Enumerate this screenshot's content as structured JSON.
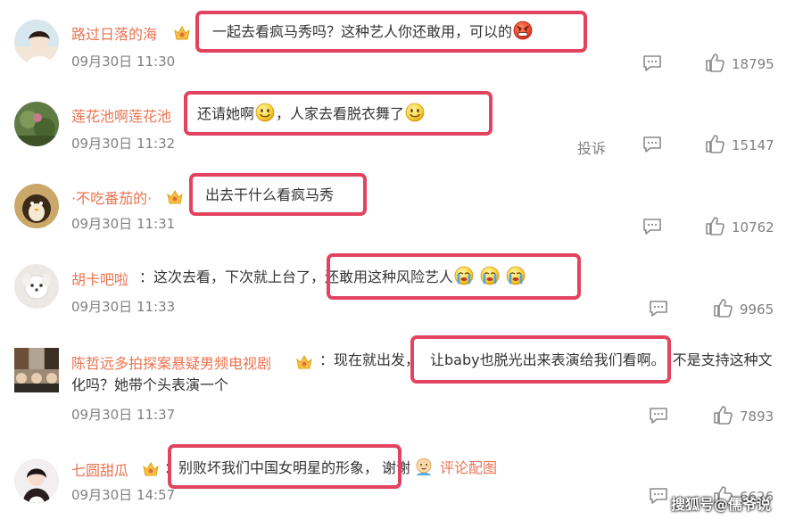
{
  "comments": [
    {
      "username": "路过日落的海",
      "text": "一起去看疯马秀吗？这种艺人你还敢用，可以的",
      "time": "09月30日 11:30",
      "likes": "18795"
    },
    {
      "username": "莲花池啊莲花池",
      "text_a": "还请她啊",
      "text_b": "，人家去看脱衣舞了",
      "time": "09月30日 11:32",
      "likes": "15147",
      "report": "投诉"
    },
    {
      "username": "·不吃番茄的·",
      "text": "出去干什么看疯马秀",
      "time": "09月30日 11:31",
      "likes": "10762"
    },
    {
      "username": "胡卡吧啦",
      "text_a": "：这次去看，下次就上台了，",
      "text_b": "还敢用这种风险艺人",
      "time": "09月30日 11:33",
      "likes": "9965"
    },
    {
      "username": "陈哲远多拍探案悬疑男频电视剧",
      "text_a": "：现在就出发，",
      "text_b": "让baby也脱光出来表演给我们看啊。",
      "text_c": "不是支持这种文",
      "text_d": "化吗？她带个头表演一个",
      "time": "09月30日 11:37",
      "likes": "7893"
    },
    {
      "username": "七圆甜瓜",
      "text_a": "：",
      "text_b": "别败坏我们中国女明星的形象，",
      "text_c": "谢谢",
      "link": "评论配图",
      "time": "09月30日 14:57",
      "likes": "6626"
    }
  ],
  "watermark": "搜狐号@儒爷说",
  "colors": {
    "username": "#eb7350",
    "highlight": "#e2445f",
    "meta": "#808080"
  }
}
